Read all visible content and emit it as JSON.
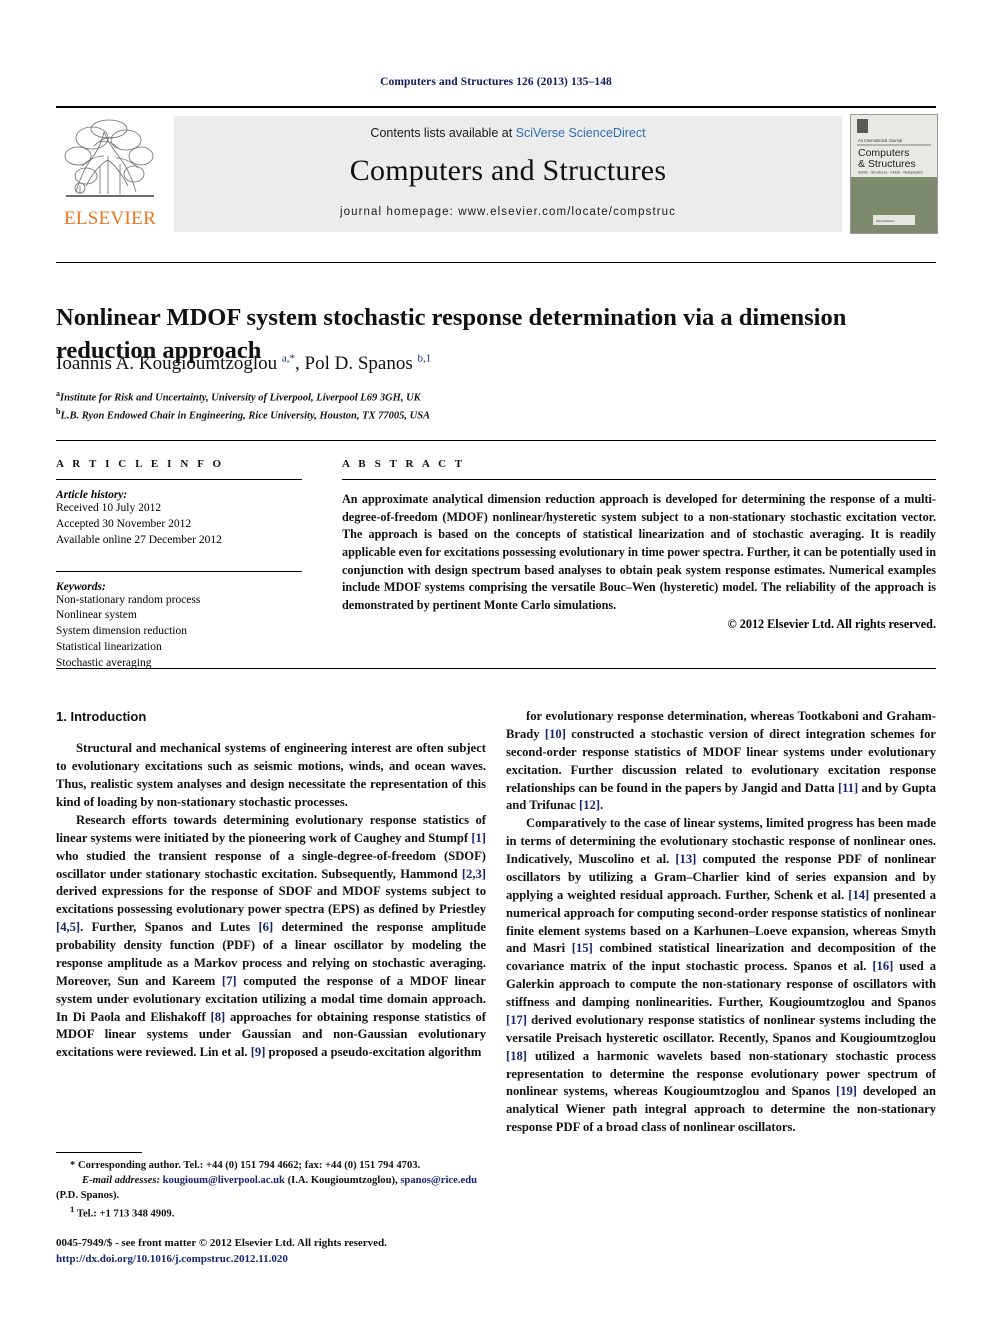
{
  "running_head": "Computers and Structures 126 (2013) 135–148",
  "masthead": {
    "publisher_logo_name": "elsevier-tree-logo",
    "publisher_wordmark": "ELSEVIER",
    "contents_prefix": "Contents lists available at ",
    "contents_link": "SciVerse ScienceDirect",
    "journal_name": "Computers and Structures",
    "homepage_label": "journal homepage: www.elsevier.com/locate/compstruc",
    "cover": {
      "kicker": "An International Journal",
      "line1": "Computers",
      "line2": "& Structures",
      "subline": "Solids · Structures · Fluids · Multiphysics",
      "footer": "Available online at ScienceDirect"
    }
  },
  "article": {
    "title": "Nonlinear MDOF system stochastic response determination via a dimension reduction approach",
    "authors_html": "Ioannis A. Kougioumtzoglou <sup>a,*</sup>, Pol D. Spanos <sup>b,1</sup>",
    "affiliations": [
      "Institute for Risk and Uncertainty, University of Liverpool, Liverpool L69 3GH, UK",
      "L.B. Ryon Endowed Chair in Engineering, Rice University, Houston, TX 77005, USA"
    ],
    "affiliation_markers": [
      "a",
      "b"
    ]
  },
  "article_info": {
    "heading": "A R T I C L E   I N F O",
    "history_label": "Article history:",
    "history": [
      "Received 10 July 2012",
      "Accepted 30 November 2012",
      "Available online 27 December 2012"
    ],
    "keywords_label": "Keywords:",
    "keywords": [
      "Non-stationary random process",
      "Nonlinear system",
      "System dimension reduction",
      "Statistical linearization",
      "Stochastic averaging"
    ]
  },
  "abstract": {
    "heading": "A B S T R A C T",
    "text": "An approximate analytical dimension reduction approach is developed for determining the response of a multi-degree-of-freedom (MDOF) nonlinear/hysteretic system subject to a non-stationary stochastic excitation vector. The approach is based on the concepts of statistical linearization and of stochastic averaging. It is readily applicable even for excitations possessing evolutionary in time power spectra. Further, it can be potentially used in conjunction with design spectrum based analyses to obtain peak system response estimates. Numerical examples include MDOF systems comprising the versatile Bouc–Wen (hysteretic) model. The reliability of the approach is demonstrated by pertinent Monte Carlo simulations.",
    "copyright": "© 2012 Elsevier Ltd. All rights reserved."
  },
  "body": {
    "section_heading": "1. Introduction",
    "left_paragraphs": [
      "Structural and mechanical systems of engineering interest are often subject to evolutionary excitations such as seismic motions, winds, and ocean waves. Thus, realistic system analyses and design necessitate the representation of this kind of loading by non-stationary stochastic processes.",
      "Research efforts towards determining evolutionary response statistics of linear systems were initiated by the pioneering work of Caughey and Stumpf [1] who studied the transient response of a single-degree-of-freedom (SDOF) oscillator under stationary stochastic excitation. Subsequently, Hammond [2,3] derived expressions for the response of SDOF and MDOF systems subject to excitations possessing evolutionary power spectra (EPS) as defined by Priestley [4,5]. Further, Spanos and Lutes [6] determined the response amplitude probability density function (PDF) of a linear oscillator by modeling the response amplitude as a Markov process and relying on stochastic averaging. Moreover, Sun and Kareem [7] computed the response of a MDOF linear system under evolutionary excitation utilizing a modal time domain approach. In Di Paola and Elishakoff [8] approaches for obtaining response statistics of MDOF linear systems under Gaussian and non-Gaussian evolutionary excitations were reviewed. Lin et al. [9] proposed a pseudo-excitation algorithm"
    ],
    "right_paragraphs": [
      "for evolutionary response determination, whereas Tootkaboni and Graham-Brady [10] constructed a stochastic version of direct integration schemes for second-order response statistics of MDOF linear systems under evolutionary excitation. Further discussion related to evolutionary excitation response relationships can be found in the papers by Jangid and Datta [11] and by Gupta and Trifunac [12].",
      "Comparatively to the case of linear systems, limited progress has been made in terms of determining the evolutionary stochastic response of nonlinear ones. Indicatively, Muscolino et al. [13] computed the response PDF of nonlinear oscillators by utilizing a Gram–Charlier kind of series expansion and by applying a weighted residual approach. Further, Schenk et al. [14] presented a numerical approach for computing second-order response statistics of nonlinear finite element systems based on a Karhunen–Loeve expansion, whereas Smyth and Masri [15] combined statistical linearization and decomposition of the covariance matrix of the input stochastic process. Spanos et al. [16] used a Galerkin approach to compute the non-stationary response of oscillators with stiffness and damping nonlinearities. Further, Kougioumtzoglou and Spanos [17] derived evolutionary response statistics of nonlinear systems including the versatile Preisach hysteretic oscillator. Recently, Spanos and Kougioumtzoglou [18] utilized a harmonic wavelets based non-stationary stochastic process representation to determine the response evolutionary power spectrum of nonlinear systems, whereas Kougioumtzoglou and Spanos [19] developed an analytical Wiener path integral approach to determine the non-stationary response PDF of a broad class of nonlinear oscillators."
    ],
    "reference_markers": [
      "[1]",
      "[2,3]",
      "[4,5]",
      "[6]",
      "[7]",
      "[8]",
      "[9]",
      "[10]",
      "[11]",
      "[12]",
      "[13]",
      "[14]",
      "[15]",
      "[16]",
      "[17]",
      "[18]",
      "[19]"
    ]
  },
  "footnotes": {
    "corresponding": "* Corresponding author. Tel.: +44 (0) 151 794 4662; fax: +44 (0) 151 794 4703.",
    "email_label": "E-mail addresses:",
    "email1": "kougioum@liverpool.ac.uk",
    "email1_owner": "(I.A. Kougioumtzoglou),",
    "email2": "spanos@rice.edu",
    "email2_owner": "(P.D. Spanos).",
    "tel_marker": "1",
    "tel": "Tel.: +1 713 348 4909."
  },
  "issn": {
    "line1": "0045-7949/$ - see front matter © 2012 Elsevier Ltd. All rights reserved.",
    "doi": "http://dx.doi.org/10.1016/j.compstruc.2012.11.020"
  },
  "colors": {
    "link_blue": "#2f6fb5",
    "ref_navy": "#16246e",
    "elsevier_orange": "#e87722",
    "band_gray": "#ececec"
  }
}
